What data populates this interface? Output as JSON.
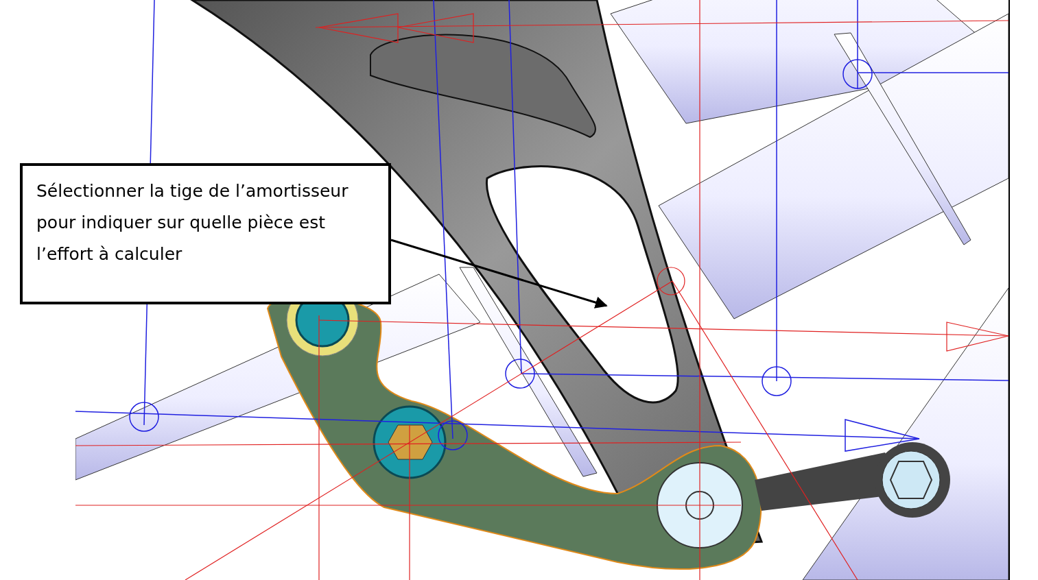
{
  "viewport": {
    "callout": {
      "text": "Sélectionner la tige de l’amortisseur pour indiquer sur quelle pièce est l’effort à calculer"
    }
  }
}
